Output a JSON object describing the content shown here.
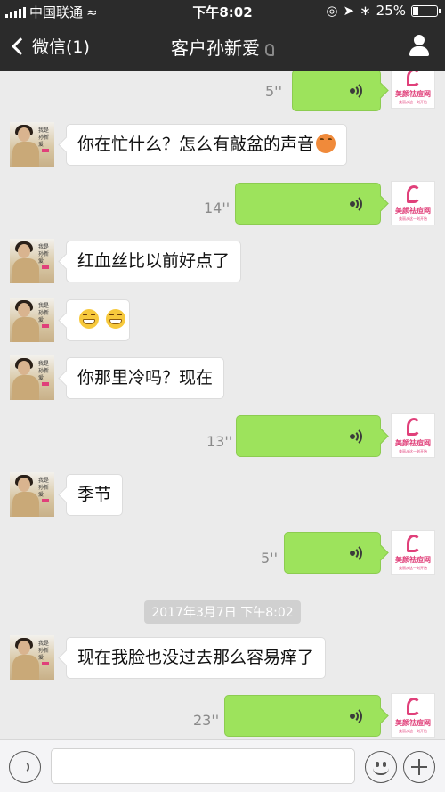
{
  "status_bar": {
    "carrier": "中国联通",
    "time": "下午8:02",
    "battery_percent": "25%",
    "battery_level": 0.25
  },
  "nav": {
    "back_label": "微信(1)",
    "title": "客户孙新爱"
  },
  "avatars": {
    "incoming_text": "我是孙新爱",
    "outgoing_brand": "美颜祛痘网",
    "outgoing_slogan": "美丽从这一刻开始"
  },
  "messages": [
    {
      "direction": "out",
      "type": "voice",
      "duration": "5''"
    },
    {
      "direction": "in",
      "type": "text",
      "text": "你在忙什么？怎么有敲盆的声音",
      "emoji": "blush"
    },
    {
      "direction": "out",
      "type": "voice",
      "duration": "14''"
    },
    {
      "direction": "in",
      "type": "text",
      "text": "红血丝比以前好点了"
    },
    {
      "direction": "in",
      "type": "emoji",
      "emojis": [
        "grin",
        "grin"
      ]
    },
    {
      "direction": "in",
      "type": "text",
      "text": "你那里冷吗？现在"
    },
    {
      "direction": "out",
      "type": "voice",
      "duration": "13''"
    },
    {
      "direction": "in",
      "type": "text",
      "text": "季节"
    },
    {
      "direction": "out",
      "type": "voice",
      "duration": "5''"
    },
    {
      "direction": "in",
      "type": "text",
      "text": "现在我脸也没过去那么容易痒了"
    },
    {
      "direction": "out",
      "type": "voice",
      "duration": "23''"
    }
  ],
  "timestamp": "2017年3月7日 下午8:02",
  "colors": {
    "header_bg": "#2b2b2b",
    "chat_bg": "#ebebeb",
    "outgoing_bubble": "#9de35c",
    "brand_pink": "#e0407a"
  }
}
